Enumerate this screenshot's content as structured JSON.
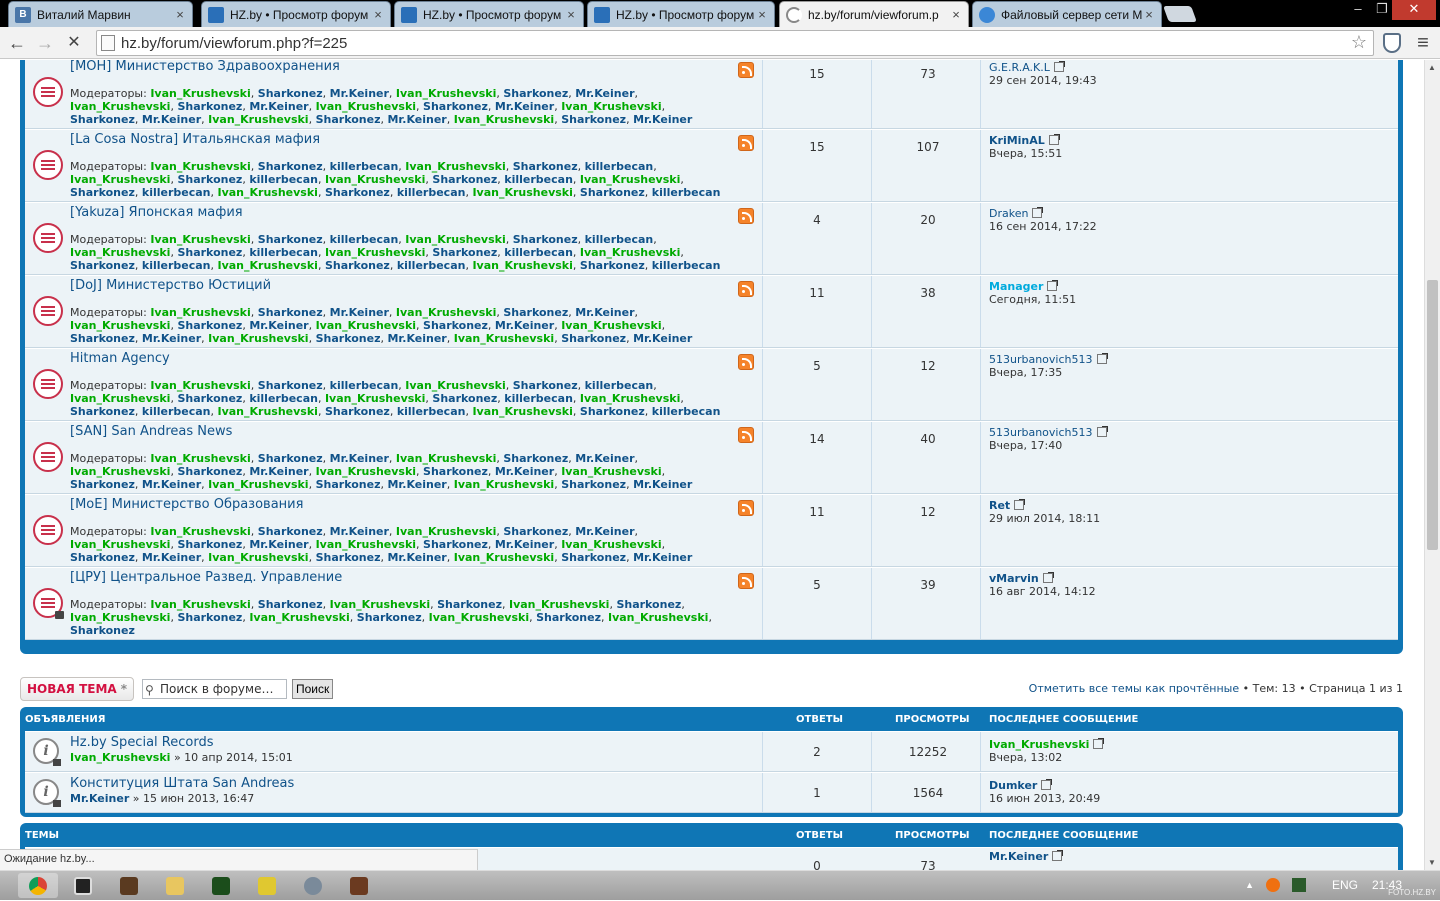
{
  "browser": {
    "tabs": [
      {
        "label": "Виталий Марвин",
        "favicon": "vk-icon",
        "color": "#4a76a8",
        "glyph": "B"
      },
      {
        "label": "HZ.by • Просмотр форум",
        "favicon": "hz-icon",
        "color": "#2a6fb8",
        "glyph": ""
      },
      {
        "label": "HZ.by • Просмотр форум",
        "favicon": "hz-icon",
        "color": "#2a6fb8",
        "glyph": ""
      },
      {
        "label": "HZ.by • Просмотр форум",
        "favicon": "hz-icon",
        "color": "#2a6fb8",
        "glyph": ""
      },
      {
        "label": "hz.by/forum/viewforum.p",
        "favicon": "loading-icon",
        "color": "#ffffff",
        "glyph": ""
      },
      {
        "label": "Файловый сервер сети M",
        "favicon": "globe-icon",
        "color": "#3b87d6",
        "glyph": ""
      }
    ],
    "tab_close": "×",
    "win_minimize": "–",
    "win_restore": "❐",
    "win_close": "✕",
    "back": "←",
    "forward": "→",
    "stop": "✕",
    "url": "hz.by/forum/viewforum.php?f=225",
    "star": "☆",
    "menu": "≡",
    "status": "Ожидание hz.by..."
  },
  "forums": [
    {
      "title": "[МОН] Министерство Здравоохранения",
      "topics": "15",
      "posts": "73",
      "last_author": "G.E.R.A.K.L",
      "author_style": "plain",
      "last_date": "29 сен 2014, 19:43",
      "locked": false,
      "mods_set": "mk"
    },
    {
      "title": "[La Cosa Nostra] Итальянская мафия",
      "topics": "15",
      "posts": "107",
      "last_author": "KriMinAL",
      "author_style": "bold",
      "last_date": "Вчера, 15:51",
      "locked": false,
      "mods_set": "kb"
    },
    {
      "title": "[Yakuza] Японская мафия",
      "topics": "4",
      "posts": "20",
      "last_author": "Draken",
      "author_style": "plain",
      "last_date": "16 сен 2014, 17:22",
      "locked": false,
      "mods_set": "kb"
    },
    {
      "title": "[DoJ] Министерство Юстиций",
      "topics": "11",
      "posts": "38",
      "last_author": "Manager",
      "author_style": "cyan",
      "last_date": "Сегодня, 11:51",
      "locked": false,
      "mods_set": "mk"
    },
    {
      "title": "Hitman Agency",
      "topics": "5",
      "posts": "12",
      "last_author": "513urbanovich513",
      "author_style": "plain",
      "last_date": "Вчера, 17:35",
      "locked": false,
      "mods_set": "kb"
    },
    {
      "title": "[SAN] San Andreas News",
      "topics": "14",
      "posts": "40",
      "last_author": "513urbanovich513",
      "author_style": "plain",
      "last_date": "Вчера, 17:40",
      "locked": false,
      "mods_set": "mk"
    },
    {
      "title": "[МоЕ] Министерство Образования",
      "topics": "11",
      "posts": "12",
      "last_author": "Ret",
      "author_style": "bold",
      "last_date": "29 июл 2014, 18:11",
      "locked": false,
      "mods_set": "mk"
    },
    {
      "title": "[ЦРУ] Центральное Развед. Управление",
      "topics": "5",
      "posts": "39",
      "last_author": "vMarvin",
      "author_style": "bold",
      "last_date": "16 авг 2014, 14:12",
      "locked": true,
      "mods_set": "iv"
    }
  ],
  "moderators_label": "Модераторы:",
  "moderators": {
    "mk": [
      [
        [
          "Ivan_Krushevski",
          "g"
        ],
        [
          "Sharkonez",
          "b"
        ],
        [
          "Mr.Keiner",
          "b"
        ],
        [
          "Ivan_Krushevski",
          "g"
        ],
        [
          "Sharkonez",
          "b"
        ],
        [
          "Mr.Keiner",
          "b"
        ]
      ],
      [
        [
          "Ivan_Krushevski",
          "g"
        ],
        [
          "Sharkonez",
          "b"
        ],
        [
          "Mr.Keiner",
          "b"
        ],
        [
          "Ivan_Krushevski",
          "g"
        ],
        [
          "Sharkonez",
          "b"
        ],
        [
          "Mr.Keiner",
          "b"
        ],
        [
          "Ivan_Krushevski",
          "g"
        ]
      ],
      [
        [
          "Sharkonez",
          "b"
        ],
        [
          "Mr.Keiner",
          "b"
        ],
        [
          "Ivan_Krushevski",
          "g"
        ],
        [
          "Sharkonez",
          "b"
        ],
        [
          "Mr.Keiner",
          "b"
        ],
        [
          "Ivan_Krushevski",
          "g"
        ],
        [
          "Sharkonez",
          "b"
        ],
        [
          "Mr.Keiner",
          "b"
        ]
      ]
    ],
    "kb": [
      [
        [
          "Ivan_Krushevski",
          "g"
        ],
        [
          "Sharkonez",
          "b"
        ],
        [
          "killerbecan",
          "b"
        ],
        [
          "Ivan_Krushevski",
          "g"
        ],
        [
          "Sharkonez",
          "b"
        ],
        [
          "killerbecan",
          "b"
        ]
      ],
      [
        [
          "Ivan_Krushevski",
          "g"
        ],
        [
          "Sharkonez",
          "b"
        ],
        [
          "killerbecan",
          "b"
        ],
        [
          "Ivan_Krushevski",
          "g"
        ],
        [
          "Sharkonez",
          "b"
        ],
        [
          "killerbecan",
          "b"
        ],
        [
          "Ivan_Krushevski",
          "g"
        ]
      ],
      [
        [
          "Sharkonez",
          "b"
        ],
        [
          "killerbecan",
          "b"
        ],
        [
          "Ivan_Krushevski",
          "g"
        ],
        [
          "Sharkonez",
          "b"
        ],
        [
          "killerbecan",
          "b"
        ],
        [
          "Ivan_Krushevski",
          "g"
        ],
        [
          "Sharkonez",
          "b"
        ],
        [
          "killerbecan",
          "b"
        ]
      ]
    ],
    "iv": [
      [
        [
          "Ivan_Krushevski",
          "g"
        ],
        [
          "Sharkonez",
          "b"
        ],
        [
          "Ivan_Krushevski",
          "g"
        ],
        [
          "Sharkonez",
          "b"
        ],
        [
          "Ivan_Krushevski",
          "g"
        ],
        [
          "Sharkonez",
          "b"
        ]
      ],
      [
        [
          "Ivan_Krushevski",
          "g"
        ],
        [
          "Sharkonez",
          "b"
        ],
        [
          "Ivan_Krushevski",
          "g"
        ],
        [
          "Sharkonez",
          "b"
        ],
        [
          "Ivan_Krushevski",
          "g"
        ],
        [
          "Sharkonez",
          "b"
        ],
        [
          "Ivan_Krushevski",
          "g"
        ]
      ],
      [
        [
          "Sharkonez",
          "b"
        ]
      ]
    ]
  },
  "actions": {
    "new_topic": "НОВАЯ ТЕМА",
    "new_topic_star": "*",
    "search_placeholder": "Поиск в форуме…",
    "search_button": "Поиск",
    "mark_read": "Отметить все темы как прочтённые",
    "topics_count": "Тем: 13",
    "page_info": "Страница 1 из 1",
    "separator": "•"
  },
  "announcements": {
    "head": {
      "title": "Объявления",
      "replies": "Ответы",
      "views": "Просмотры",
      "last": "Последнее сообщение"
    },
    "rows": [
      {
        "title": "Hz.by Special Records",
        "author": "Ivan_Krushevski",
        "author_color": "g",
        "date": "» 10 апр 2014, 15:01",
        "replies": "2",
        "views": "12252",
        "last_author": "Ivan_Krushevski",
        "last_author_color": "g",
        "last_date": "Вчера, 13:02"
      },
      {
        "title": "Конституция Штата San Andreas",
        "author": "Mr.Keiner",
        "author_color": "b",
        "date": "» 15 июн 2013, 16:47",
        "replies": "1",
        "views": "1564",
        "last_author": "Dumker",
        "last_author_color": "b",
        "last_date": "16 июн 2013, 20:49"
      }
    ]
  },
  "topics": {
    "head": {
      "title": "Темы",
      "replies": "Ответы",
      "views": "Просмотры",
      "last": "Последнее сообщение"
    },
    "rows": [
      {
        "replies": "0",
        "views": "73",
        "last_author": "Mr.Keiner"
      }
    ]
  },
  "taskbar": {
    "lang": "ENG",
    "time": "21:43",
    "watermark": "FOTO.HZ.BY"
  }
}
